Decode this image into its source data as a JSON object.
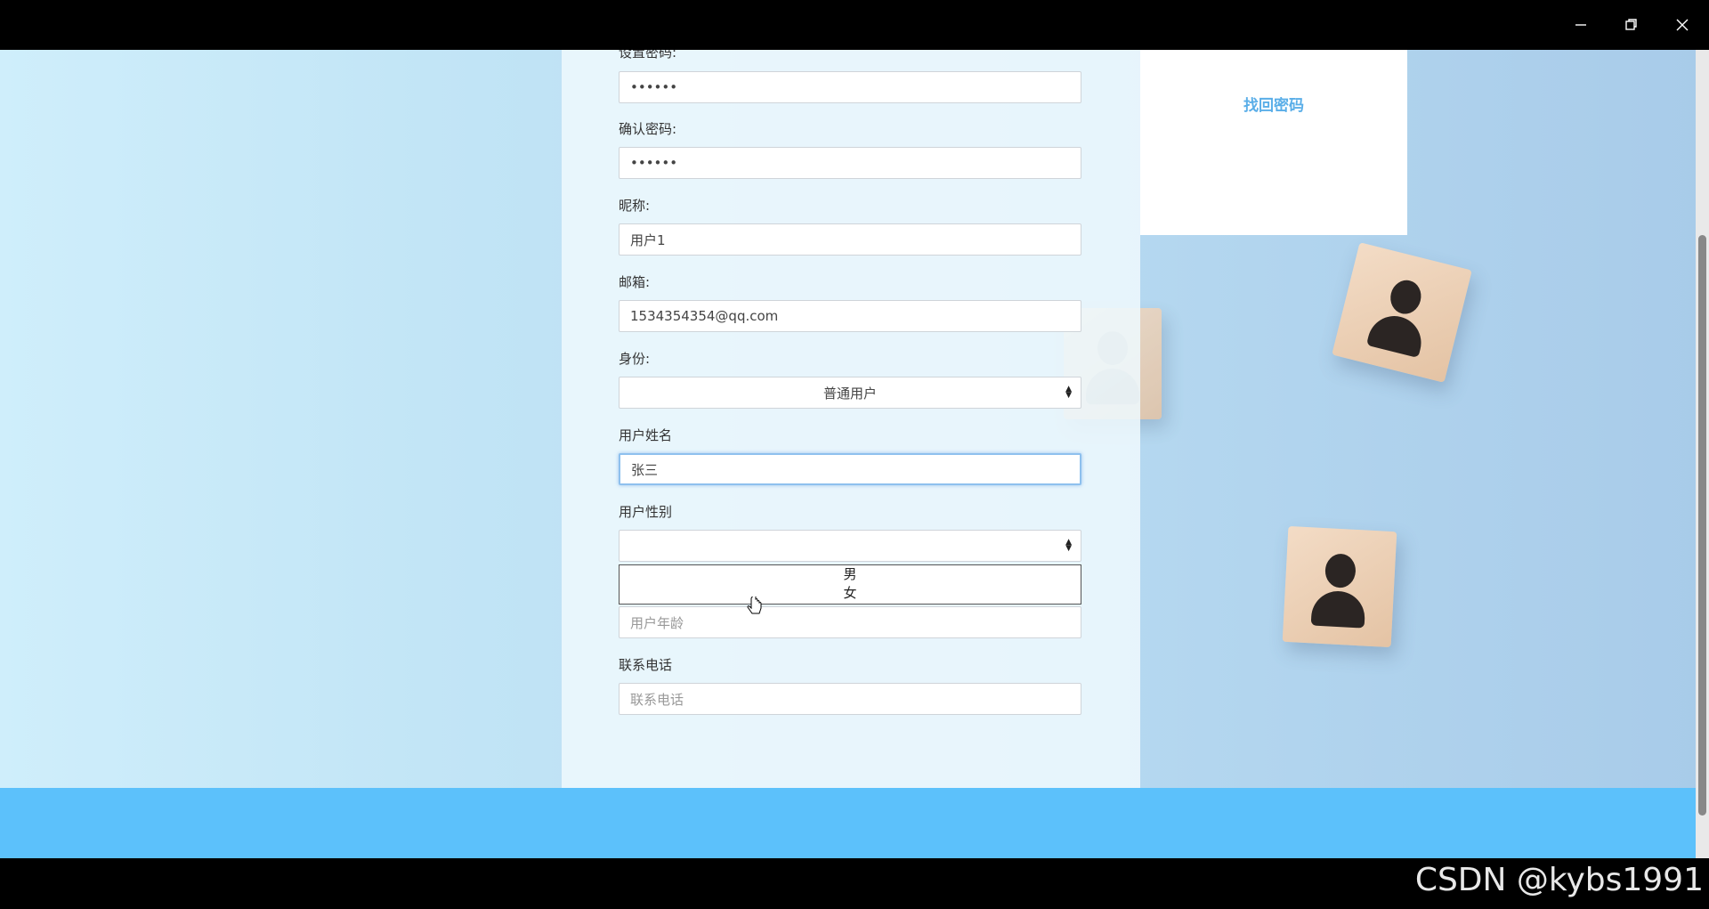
{
  "form": {
    "password_label": "设置密码:",
    "password_value": "••••••",
    "confirm_label": "确认密码:",
    "confirm_value": "••••••",
    "nickname_label": "昵称:",
    "nickname_value": "用户1",
    "email_label": "邮箱:",
    "email_value": "1534354354@qq.com",
    "identity_label": "身份:",
    "identity_value": "普通用户",
    "realname_label": "用户姓名",
    "realname_value": "张三",
    "gender_label": "用户性别",
    "gender_value": "",
    "gender_options": [
      "男",
      "女"
    ],
    "age_placeholder": "用户年龄",
    "phone_label": "联系电话",
    "phone_placeholder": "联系电话"
  },
  "side": {
    "find_password": "找回密码"
  },
  "watermark": "CSDN @kybs1991",
  "colors": {
    "footer": "#5cc1fb",
    "link": "#5aaee8"
  }
}
